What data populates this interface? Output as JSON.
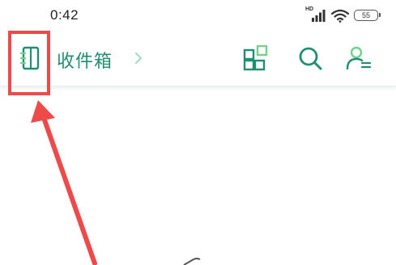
{
  "status_bar": {
    "time": "0:42",
    "network_label": "HD",
    "battery_level": "55"
  },
  "toolbar": {
    "folder_title": "收件箱",
    "nav_icon": "mailbox-list-icon",
    "chevron_icon": "chevron-right-icon",
    "actions": [
      "grid-apps-icon",
      "search-icon",
      "account-switch-icon"
    ]
  },
  "annotation": {
    "color": "#ee4a4a",
    "target": "mailbox-list-icon"
  },
  "colors": {
    "accent": "#1f8f72",
    "accent_light": "#6fd38a",
    "annotation": "#ee4a4a"
  }
}
